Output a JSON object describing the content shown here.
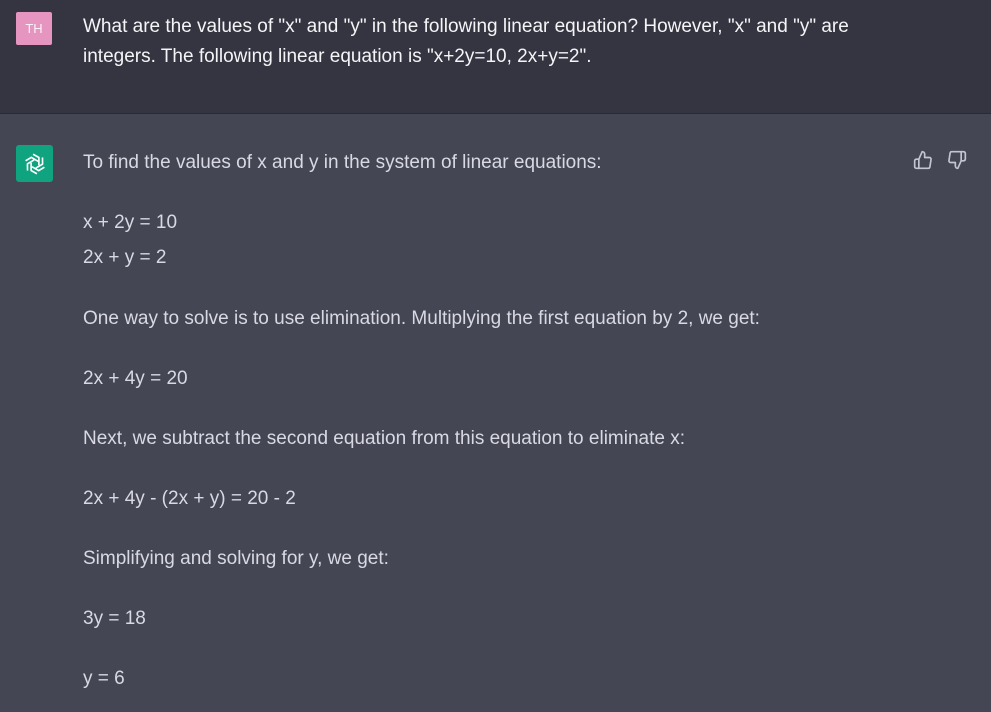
{
  "user_message": {
    "avatar_initials": "TH",
    "avatar_color": "#e695c0",
    "text": "What are the values of \"x\" and \"y\" in the following linear equation? However, \"x\" and \"y\" are integers. The following linear equation is \"x+2y=10, 2x+y=2\"."
  },
  "assistant_message": {
    "avatar_icon": "openai-logo-icon",
    "avatar_color": "#10a37f",
    "lines": [
      "To find the values of x and y in the system of linear equations:",
      "x + 2y = 10",
      "2x + y = 2",
      "One way to solve is to use elimination. Multiplying the first equation by 2, we get:",
      "2x + 4y = 20",
      "Next, we subtract the second equation from this equation to eliminate x:",
      "2x + 4y - (2x + y) = 20 - 2",
      "Simplifying and solving for y, we get:",
      "3y = 18",
      "y = 6"
    ],
    "feedback": {
      "thumbs_up_icon": "thumbs-up-icon",
      "thumbs_down_icon": "thumbs-down-icon"
    }
  }
}
